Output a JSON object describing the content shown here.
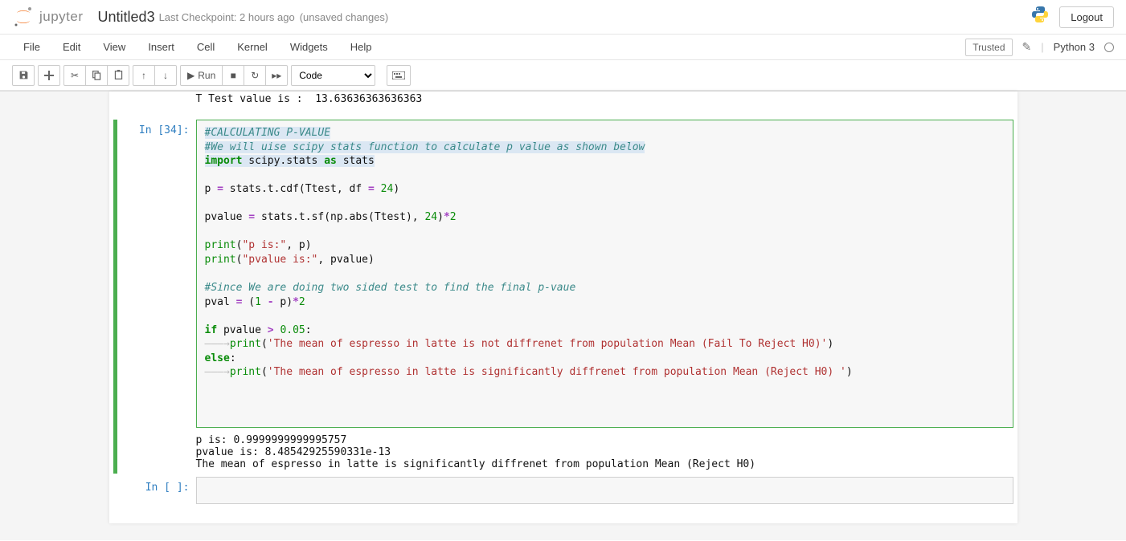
{
  "header": {
    "logo_text": "jupyter",
    "title": "Untitled3",
    "checkpoint": "Last Checkpoint: 2 hours ago",
    "unsaved": "(unsaved changes)",
    "logout": "Logout"
  },
  "menubar": {
    "items": [
      "File",
      "Edit",
      "View",
      "Insert",
      "Cell",
      "Kernel",
      "Widgets",
      "Help"
    ],
    "trusted": "Trusted",
    "kernel": "Python 3"
  },
  "toolbar": {
    "run_label": "Run",
    "cell_type": "Code"
  },
  "partial_output": "T Test value is :  13.63636363636363",
  "cell1": {
    "prompt": "In [34]:",
    "c1": "#CALCULATING P-VALUE",
    "c2": "#We will uise scipy stats function to calculate p value as shown below",
    "kw_import": "import",
    "t_scipy": " scipy.stats ",
    "kw_as": "as",
    "t_stats": " stats",
    "l4_a": "p ",
    "op_eq": "=",
    "l4_b": " stats.t.cdf(Ttest, df ",
    "l4_c": " ",
    "n24a": "24",
    "l4_d": ")",
    "l5_a": "pvalue ",
    "l5_b": " stats.t.sf(np.abs(Ttest), ",
    "n24b": "24",
    "l5_c": ")",
    "op_mul": "*",
    "n2": "2",
    "pr": "print",
    "lparen": "(",
    "s_pis": "\"p is:\"",
    "s_pvis": "\"pvalue is:\"",
    "c_p": ", p)",
    "c_pv": ", pvalue)",
    "c3": "#Since We are doing two sided test to find the final p-vaue",
    "l8_a": "pval ",
    "l8_b": " (",
    "n1": "1",
    "l8_c": " ",
    "op_min": "-",
    "l8_d": " p)",
    "kw_if": "if",
    "l9_a": " pvalue ",
    "op_gt": ">",
    "l9_b": " ",
    "n005": "0.05",
    "l9_c": ":",
    "arrow": "———→",
    "s_fail": "'The mean of espresso in latte is not diffrenet from population Mean (Fail To Reject H0)'",
    "rparen": ")",
    "kw_else": "else",
    "colon": ":",
    "s_reject": "'The mean of espresso in latte is significantly diffrenet from population Mean (Reject H0) '",
    "output": "p is: 0.9999999999995757\npvalue is: 8.48542925590331e-13\nThe mean of espresso in latte is significantly diffrenet from population Mean (Reject H0)"
  },
  "cell2": {
    "prompt": "In [ ]:"
  }
}
